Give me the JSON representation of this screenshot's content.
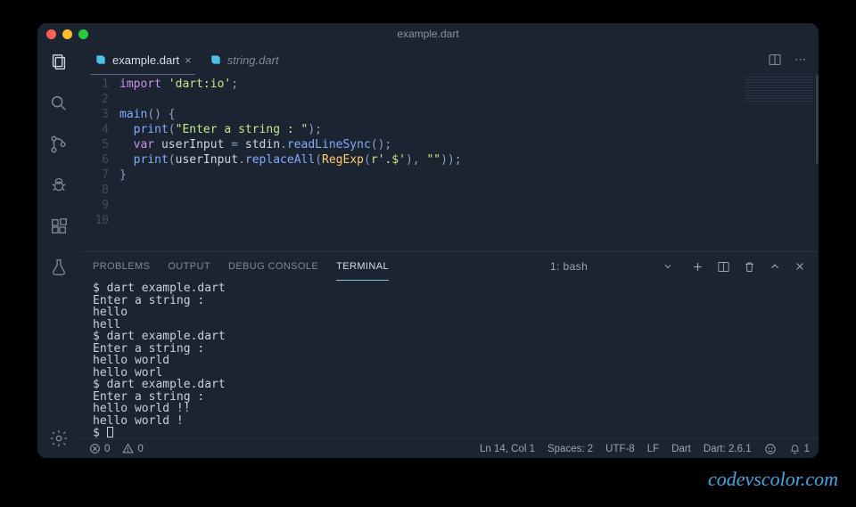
{
  "title": "example.dart",
  "tabs": [
    {
      "label": "example.dart",
      "italic": false,
      "close": true
    },
    {
      "label": "string.dart",
      "italic": true,
      "close": false
    }
  ],
  "code": {
    "lines": [
      "1",
      "2",
      "3",
      "4",
      "5",
      "6",
      "7",
      "8",
      "9",
      "10"
    ],
    "l1_kw": "import",
    "l1_str": "'dart:io'",
    "l1_p": ";",
    "l3_fn": "main",
    "l3_p": "() {",
    "l4_fn": "print",
    "l4_p1": "(",
    "l4_str": "\"Enter a string : \"",
    "l4_p2": ");",
    "l5_kw": "var",
    "l5_id": " userInput ",
    "l5_eq": "= ",
    "l5_o1": "stdin",
    "l5_dot1": ".",
    "l5_m1": "readLineSync",
    "l5_p": "();",
    "l6_fn": "print",
    "l6_p1": "(",
    "l6_o1": "userInput",
    "l6_dot1": ".",
    "l6_m1": "replaceAll",
    "l6_p2": "(",
    "l6_type": "RegExp",
    "l6_p3": "(",
    "l6_str1": "r'.$'",
    "l6_p4": "), ",
    "l6_str2": "\"\"",
    "l6_p5": "));",
    "l7": "}"
  },
  "panel_tabs": [
    "PROBLEMS",
    "OUTPUT",
    "DEBUG CONSOLE",
    "TERMINAL"
  ],
  "terminal_selector": "1: bash",
  "terminal_output": "$ dart example.dart\nEnter a string :\nhello\nhell\n$ dart example.dart\nEnter a string :\nhello world\nhello worl\n$ dart example.dart\nEnter a string :\nhello world !!\nhello world !\n$ ",
  "status": {
    "errors": "0",
    "warnings": "0",
    "position": "Ln 14, Col 1",
    "spaces": "Spaces: 2",
    "encoding": "UTF-8",
    "eol": "LF",
    "lang": "Dart",
    "sdk": "Dart: 2.6.1",
    "bell": "1"
  },
  "watermark": "codevscolor.com"
}
